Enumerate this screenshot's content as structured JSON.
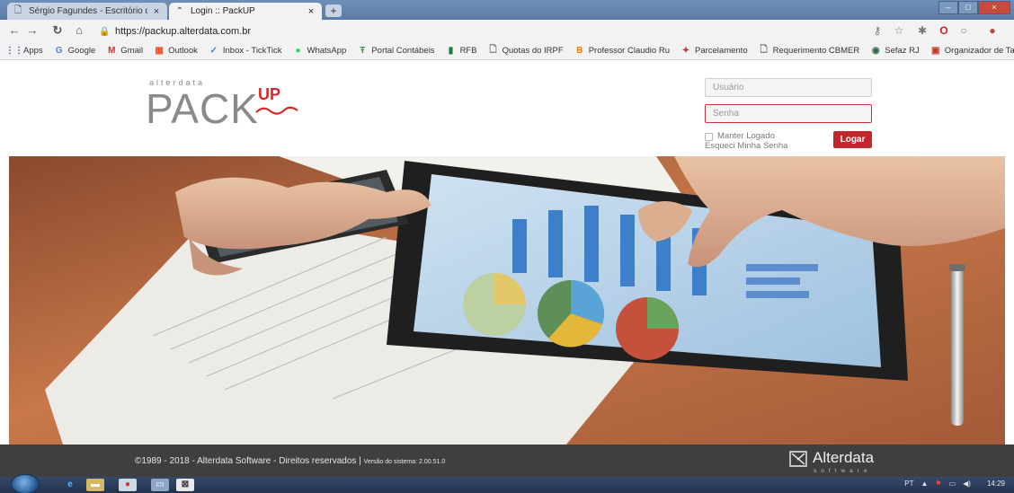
{
  "browser": {
    "tabs": [
      {
        "title": "Sérgio Fagundes - Escritório de"
      },
      {
        "title": "Login :: PackUP"
      }
    ],
    "url": "https://packup.alterdata.com.br",
    "bookmarks": [
      {
        "label": "Apps",
        "icon": "apps-grid-icon"
      },
      {
        "label": "Google",
        "icon": "google-icon"
      },
      {
        "label": "Gmail",
        "icon": "gmail-icon"
      },
      {
        "label": "Outlook",
        "icon": "outlook-icon"
      },
      {
        "label": "Inbox - TickTick",
        "icon": "ticktick-icon"
      },
      {
        "label": "WhatsApp",
        "icon": "whatsapp-icon"
      },
      {
        "label": "Portal Contábeis",
        "icon": "portal-icon"
      },
      {
        "label": "RFB",
        "icon": "rfb-icon"
      },
      {
        "label": "Quotas do IRPF",
        "icon": "document-icon"
      },
      {
        "label": "Professor Claudio Ru",
        "icon": "blogger-icon"
      },
      {
        "label": "Parcelamento",
        "icon": "parcelamento-icon"
      },
      {
        "label": "Requerimento CBMER",
        "icon": "document-icon"
      },
      {
        "label": "Sefaz RJ",
        "icon": "sefaz-icon"
      },
      {
        "label": "Organizador de Taref",
        "icon": "organizer-icon"
      }
    ]
  },
  "login": {
    "logo_small": "alterdata",
    "logo_main": "PACK",
    "logo_up": "UP",
    "username_placeholder": "Usuário",
    "password_placeholder": "Senha",
    "remember_label": "Manter Logado",
    "forgot_label": "Esqueci Minha Senha",
    "submit_label": "Logar"
  },
  "footer": {
    "copyright": "©1989 - 2018 - Alterdata Software - Direitos reservados |",
    "version": "Versão do sistema: 2.00.51.0",
    "brand": "Alterdata",
    "brand_sub": "software"
  },
  "taskbar": {
    "language": "PT",
    "clock": "14:29"
  },
  "colors": {
    "accent_red": "#c3262c",
    "footer_bg": "#3f3f3f"
  }
}
